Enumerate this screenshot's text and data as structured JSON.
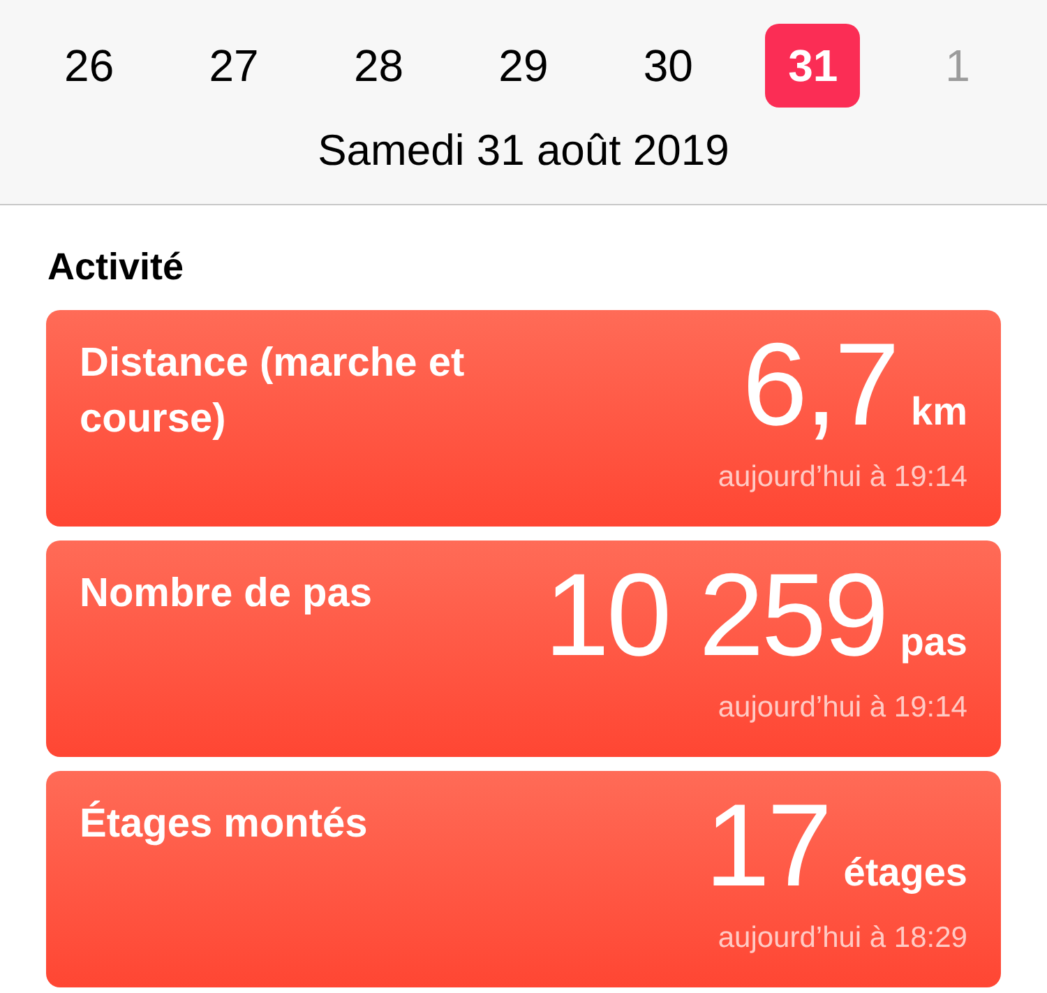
{
  "days": [
    {
      "label": "26",
      "selected": false,
      "disabled": false
    },
    {
      "label": "27",
      "selected": false,
      "disabled": false
    },
    {
      "label": "28",
      "selected": false,
      "disabled": false
    },
    {
      "label": "29",
      "selected": false,
      "disabled": false
    },
    {
      "label": "30",
      "selected": false,
      "disabled": false
    },
    {
      "label": "31",
      "selected": true,
      "disabled": false
    },
    {
      "label": "1",
      "selected": false,
      "disabled": true
    }
  ],
  "date": "Samedi 31 août 2019",
  "section_title": "Activité",
  "cards": [
    {
      "title": "Distance (marche et course)",
      "value": "6,7",
      "unit": "km",
      "updated": "aujourd’hui à 19:14"
    },
    {
      "title": "Nombre de pas",
      "value": "10 259",
      "unit": "pas",
      "updated": "aujourd’hui à 19:14"
    },
    {
      "title": "Étages montés",
      "value": "17",
      "unit": "étages",
      "updated": "aujourd’hui à 18:29"
    }
  ]
}
